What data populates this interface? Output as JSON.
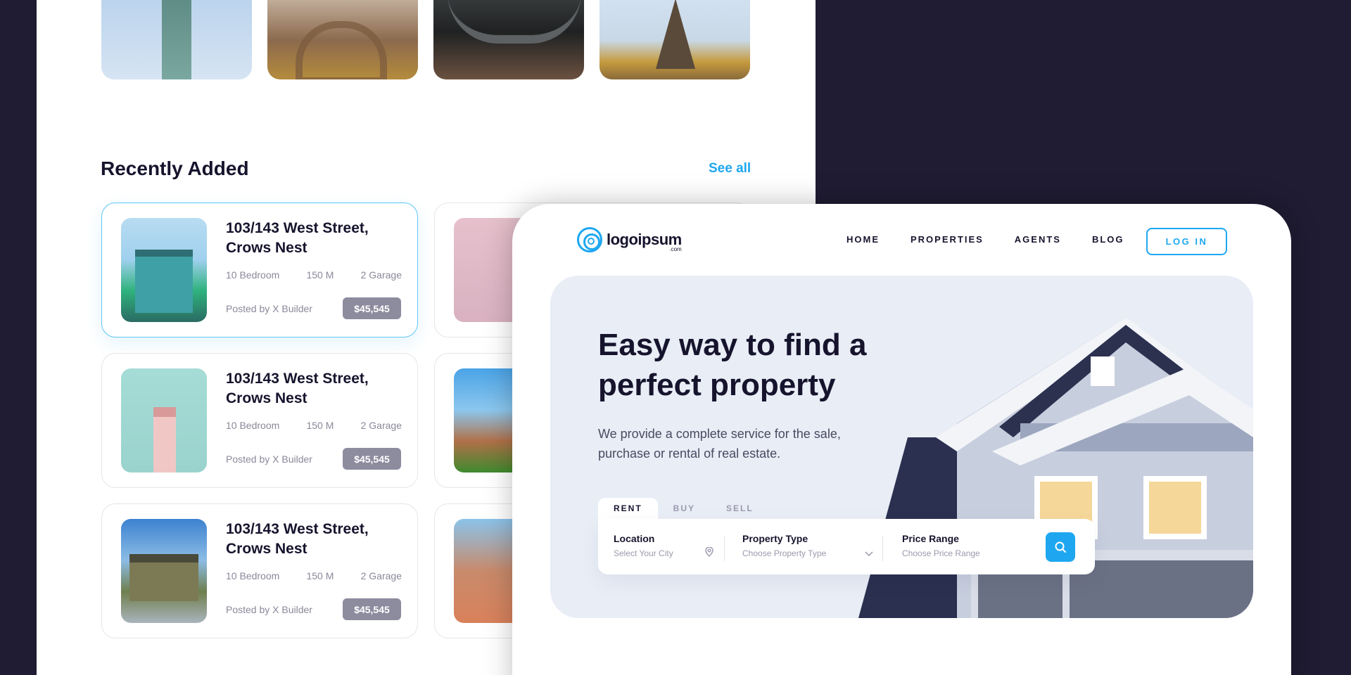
{
  "back": {
    "destinations": [
      "statue-of-liberty",
      "old-town",
      "bridge",
      "eiffel-tower"
    ],
    "section_title": "Recently Added",
    "see_all": "See all",
    "cards": [
      {
        "title": "103/143 West Street, Crows Nest",
        "bedrooms": "10 Bedroom",
        "area": "150 M",
        "garage": "2 Garage",
        "posted": "Posted by X Builder",
        "price": "$45,545"
      },
      {
        "title": "103/143 West Street, Crows Nest",
        "bedrooms": "10 Bedroom",
        "area": "150 M",
        "garage": "2 Garage",
        "posted": "Posted by X Builder",
        "price": "$45,545"
      },
      {
        "title": "103/143 West Street, Crows Nest",
        "bedrooms": "10 Bedroom",
        "area": "150 M",
        "garage": "2 Garage",
        "posted": "Posted by X Builder",
        "price": "$45,545"
      }
    ]
  },
  "front": {
    "logo": {
      "name": "logoipsum",
      "suffix": ".com"
    },
    "nav": [
      "HOME",
      "PROPERTIES",
      "AGENTS",
      "BLOG"
    ],
    "login": "LOG IN",
    "hero": {
      "title": "Easy way to find a perfect property",
      "description": "We provide a complete service for the sale, purchase or rental of real estate."
    },
    "tabs": [
      "RENT",
      "BUY",
      "SELL"
    ],
    "active_tab": "RENT",
    "search": {
      "location": {
        "label": "Location",
        "placeholder": "Select Your City",
        "icon": "map-pin-icon"
      },
      "property_type": {
        "label": "Property Type",
        "placeholder": "Choose Property Type",
        "icon": "chevron-down-icon"
      },
      "price_range": {
        "label": "Price Range",
        "placeholder": "Choose Price Range"
      },
      "button_icon": "search-icon"
    }
  },
  "colors": {
    "background": "#1f1c33",
    "accent": "#1ea7f0",
    "text": "#16142d",
    "price_badge": "#8d8b9e",
    "hero_bg": "#e9edf6"
  }
}
